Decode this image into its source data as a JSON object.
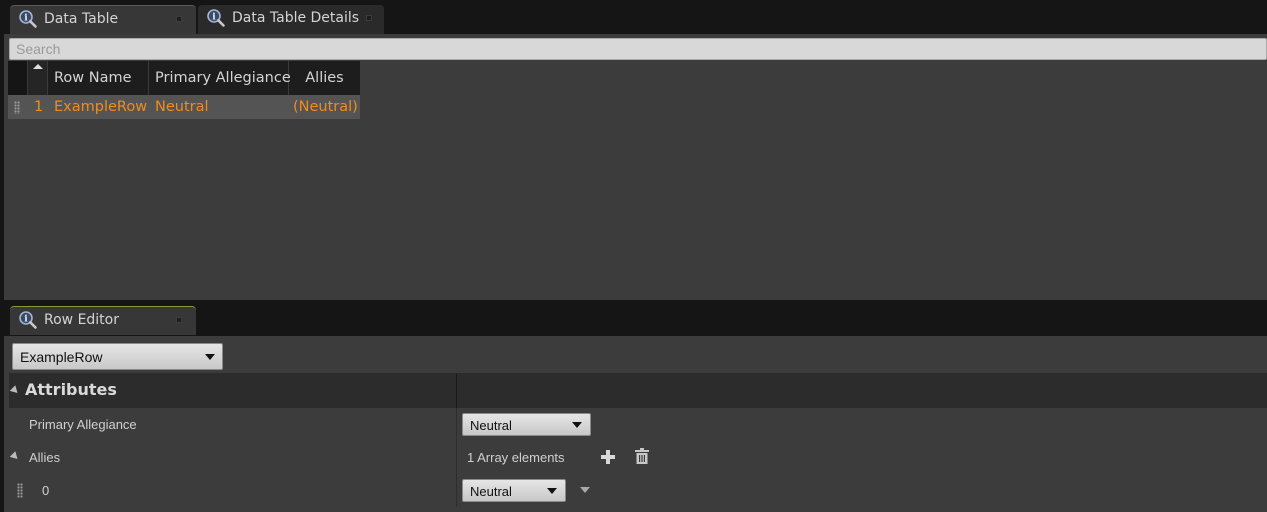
{
  "top_tabs": [
    {
      "label": "Data Table",
      "active": true
    },
    {
      "label": "Data Table Details",
      "active": false
    }
  ],
  "search": {
    "placeholder": "Search",
    "value": ""
  },
  "table": {
    "columns": [
      "Row Name",
      "Primary Allegiance",
      "Allies"
    ],
    "rows": [
      {
        "index": "1",
        "row_name": "ExampleRow",
        "primary_allegiance": "Neutral",
        "allies": "(Neutral)"
      }
    ]
  },
  "bottom_tab": {
    "label": "Row Editor"
  },
  "row_selector": {
    "value": "ExampleRow"
  },
  "attributes": {
    "section_title": "Attributes",
    "primary_allegiance": {
      "label": "Primary Allegiance",
      "value": "Neutral"
    },
    "allies": {
      "label": "Allies",
      "count_text": "1 Array elements",
      "items": [
        {
          "index": "0",
          "value": "Neutral"
        }
      ]
    }
  },
  "colors": {
    "accent_text": "#f08c1c",
    "panel": "#3c3c3c",
    "tab_strip": "#151515"
  },
  "icons": {
    "tab_icon": "info-magnifier-icon",
    "add": "plus-icon",
    "remove": "trash-icon"
  }
}
